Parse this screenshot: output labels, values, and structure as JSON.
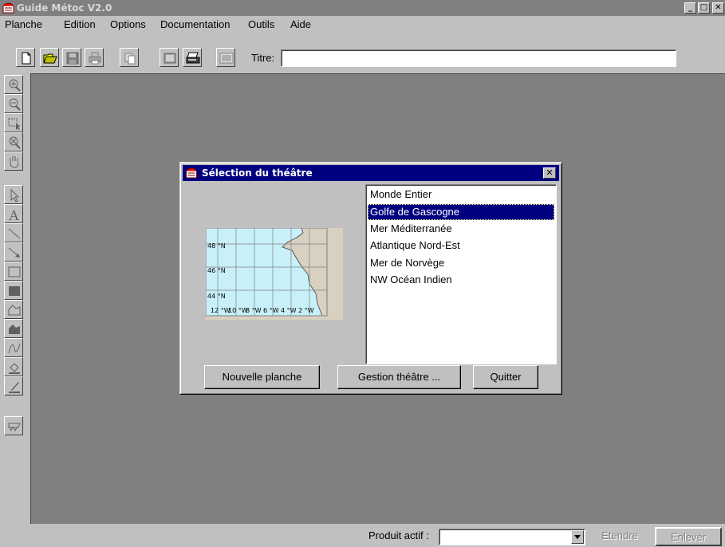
{
  "window": {
    "title": "Guide Métoc V2.0",
    "controls": [
      "_",
      "□",
      "✕"
    ]
  },
  "menu": [
    {
      "label": "Planche"
    },
    {
      "label": "Edition"
    },
    {
      "label": "Options"
    },
    {
      "label": "Documentation"
    },
    {
      "label": "Outils"
    },
    {
      "label": "Aide"
    }
  ],
  "toolbar": {
    "buttons": [
      "new-document-icon",
      "open-folder-icon",
      "save-icon",
      "print-icon",
      "copy-icon",
      "preview-icon",
      "print-setup-icon",
      "image-icon"
    ],
    "titre_label": "Titre:",
    "titre_value": ""
  },
  "palette": {
    "tools": [
      "zoom-in-icon",
      "zoom-out-icon",
      "select-region-icon",
      "zoom-reset-icon",
      "pan-hand-icon",
      "pointer-icon",
      "text-tool-icon",
      "line-tool-icon",
      "arrow-tool-icon",
      "rectangle-tool-icon",
      "filled-rectangle-tool-icon",
      "polygon-tool-icon",
      "filled-polygon-tool-icon",
      "curve-tool-icon",
      "fill-tool-icon",
      "pen-tool-icon",
      "front-symbol-icon"
    ]
  },
  "dialog": {
    "title": "Sélection du théâtre",
    "map": {
      "lat_labels": [
        "48 °N",
        "46 °N",
        "44 °N"
      ],
      "lon_labels": [
        "12 °W",
        "10 °W",
        "8 °W",
        "6 °W",
        "4 °W",
        "2 °W"
      ],
      "sea_color": "#c8f0f8",
      "land_color": "#d8d0c0"
    },
    "theatres": [
      {
        "label": "Monde Entier",
        "selected": false
      },
      {
        "label": "Golfe de Gascogne",
        "selected": true
      },
      {
        "label": "Mer Méditerranée",
        "selected": false
      },
      {
        "label": "Atlantique Nord-Est",
        "selected": false
      },
      {
        "label": "Mer de Norvège",
        "selected": false
      },
      {
        "label": "NW Océan Indien",
        "selected": false
      }
    ],
    "buttons": {
      "new_planche": "Nouvelle planche",
      "gestion": "Gestion théâtre ...",
      "quit": "Quitter"
    }
  },
  "statusbar": {
    "produit_label": "Produit actif :",
    "produit_value": "",
    "etendre": "Etendre",
    "enlever": "Enlever"
  },
  "colors": {
    "desktop": "#808080",
    "chrome": "#c0c0c0",
    "selection": "#000080"
  }
}
